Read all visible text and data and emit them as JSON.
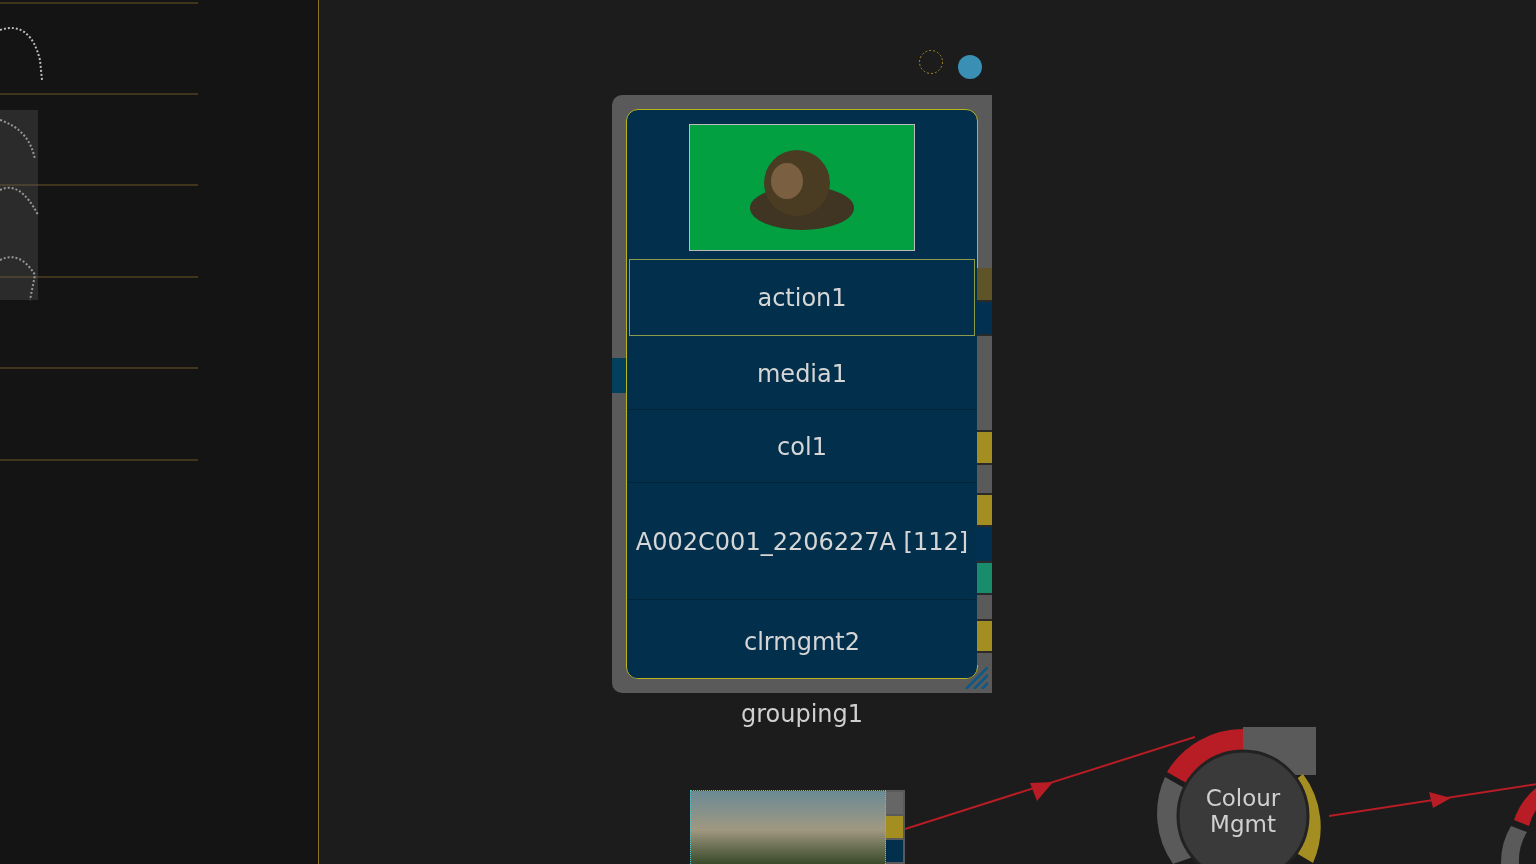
{
  "group_node": {
    "title": "grouping1",
    "items": [
      {
        "label": "action1",
        "selected": true
      },
      {
        "label": "media1",
        "selected": false
      },
      {
        "label": "col1",
        "selected": false
      },
      {
        "label": "A002C001_2206227A [112]",
        "selected": false
      },
      {
        "label": "clrmgmt2",
        "selected": false
      }
    ]
  },
  "colour_node": {
    "label": "Colour\nMgmt"
  }
}
